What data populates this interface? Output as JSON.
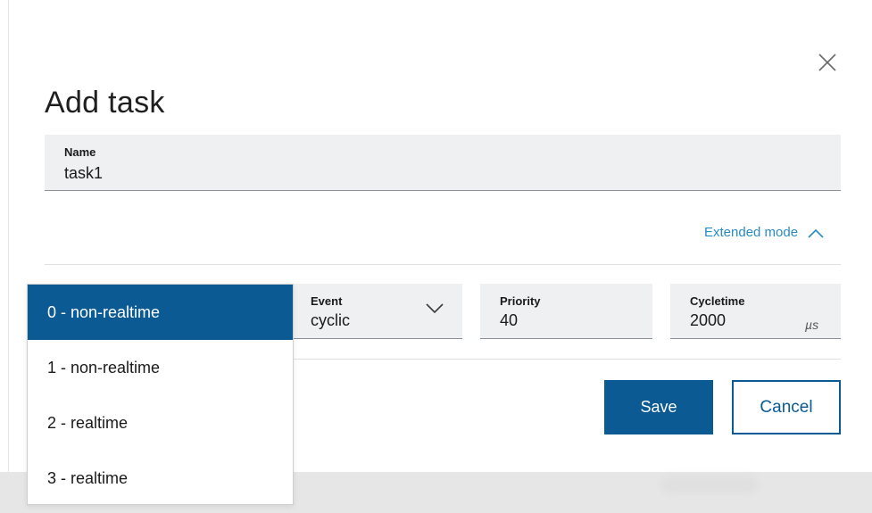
{
  "dialog": {
    "title": "Add task",
    "close_icon": "close-icon"
  },
  "name_field": {
    "label": "Name",
    "value": "task1"
  },
  "extended_mode": {
    "label": "Extended mode",
    "icon": "chevron-up-icon"
  },
  "event_field": {
    "label": "Event",
    "value": "cyclic",
    "icon": "chevron-down-icon"
  },
  "priority_field": {
    "label": "Priority",
    "value": "40"
  },
  "cycletime_field": {
    "label": "Cycletime",
    "value": "2000",
    "unit": "µs"
  },
  "buttons": {
    "save": "Save",
    "cancel": "Cancel"
  },
  "type_dropdown": {
    "options": [
      "0 - non-realtime",
      "1 - non-realtime",
      "2 - realtime",
      "3 - realtime"
    ],
    "selected_index": 0
  },
  "colors": {
    "primary": "#0b5a94",
    "link": "#2a8bc4",
    "field_bg": "#eff0f1"
  }
}
